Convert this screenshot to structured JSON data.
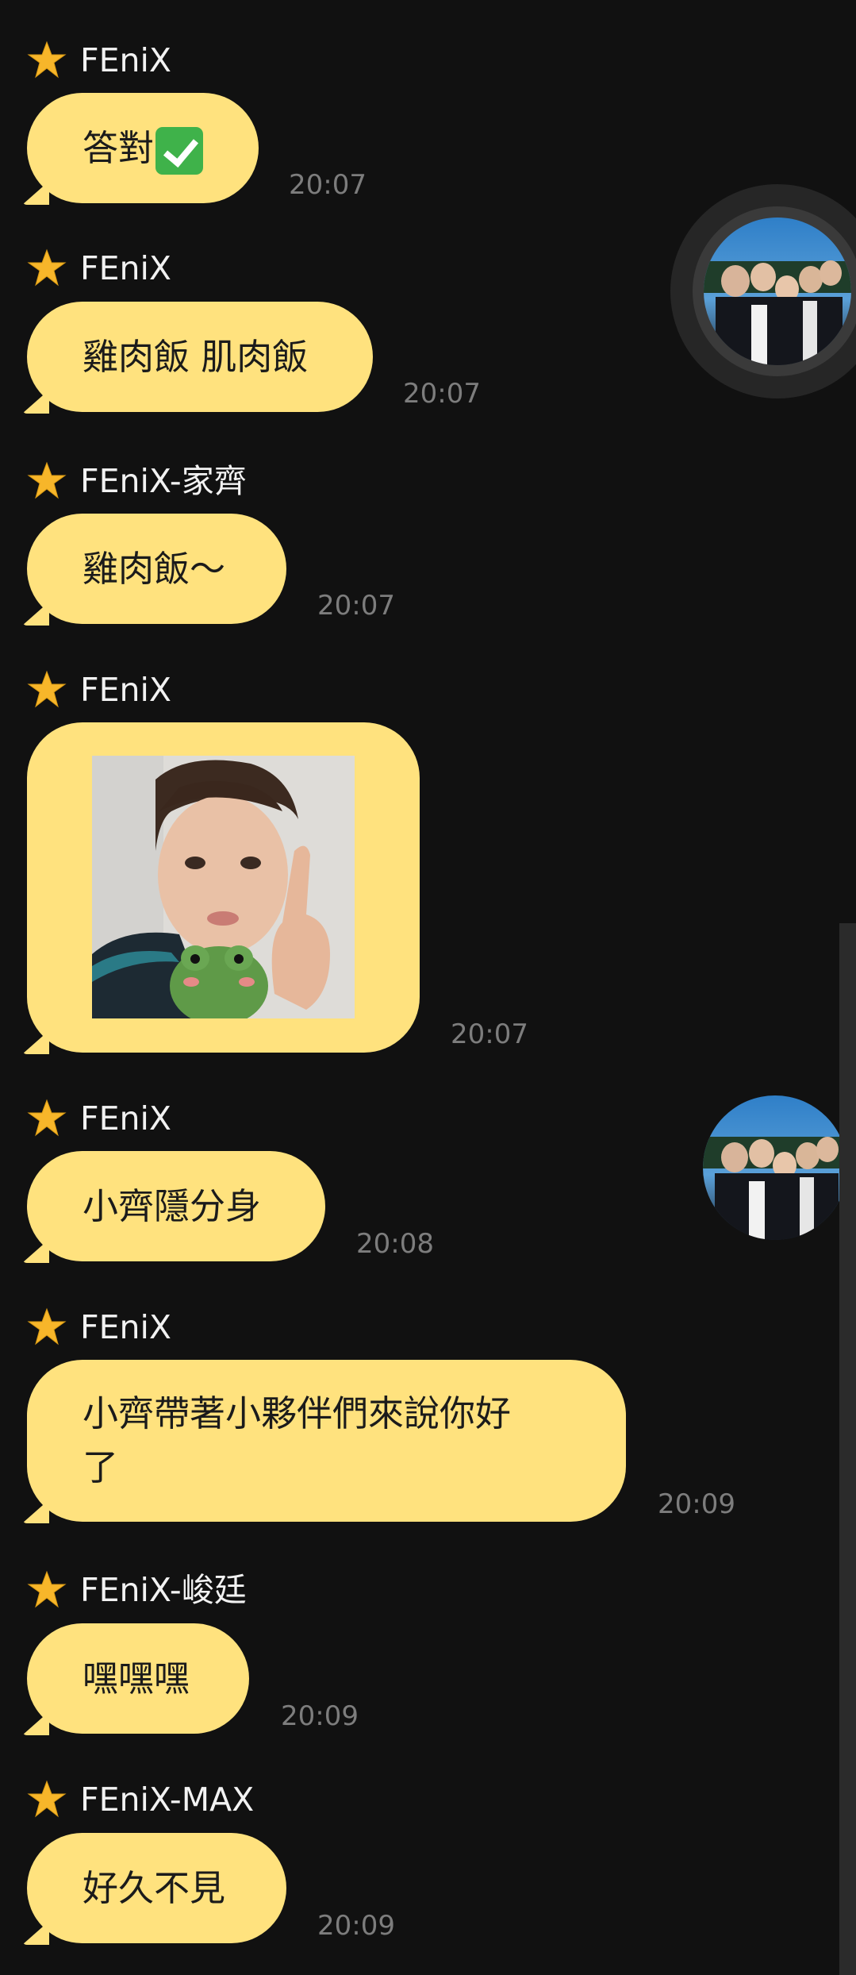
{
  "chat": {
    "messages": [
      {
        "sender": "FEniX",
        "text": "答對",
        "time": "20:07"
      },
      {
        "sender": "FEniX",
        "text": "雞肉飯 肌肉飯",
        "time": "20:07"
      },
      {
        "sender": "FEniX-家齊",
        "text": "雞肉飯～",
        "time": "20:07"
      },
      {
        "sender": "FEniX",
        "image": "selfie-with-frog-plush",
        "time": "20:07"
      },
      {
        "sender": "FEniX",
        "text": "小齊隱分身",
        "time": "20:08"
      },
      {
        "sender": "FEniX",
        "text": "小齊帶著小夥伴們來說你好\n了",
        "time": "20:09"
      },
      {
        "sender": "FEniX-峻廷",
        "text": "嘿嘿嘿",
        "time": "20:09"
      },
      {
        "sender": "FEniX-MAX",
        "text": "好久不見",
        "time": "20:09"
      }
    ]
  },
  "colors": {
    "background": "#111111",
    "bubble": "#ffe27e",
    "star": "#f7b62a",
    "time": "#7d7d7d",
    "sender": "#f2f2f2"
  },
  "icons": {
    "star": "star-icon",
    "check": "check-mark-emoji"
  }
}
